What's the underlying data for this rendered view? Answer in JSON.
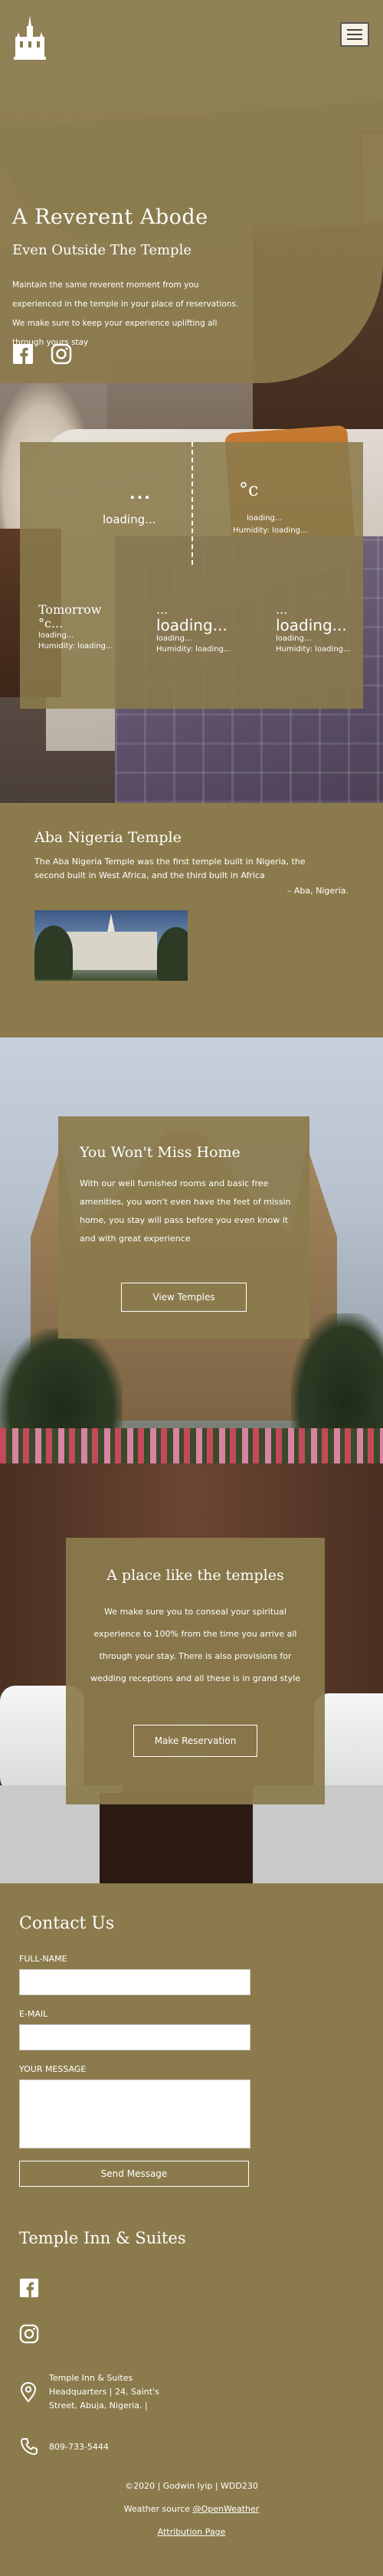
{
  "header": {
    "menu_icon": "hamburger-icon",
    "logo_icon": "temple-logo-icon"
  },
  "hero": {
    "title": "A Reverent Abode",
    "subtitle": "Even Outside The Temple",
    "description": "Maintain the same reverent moment from you experienced in the temple in your place of reservations. We make sure to keep your experience uplifting all through yours stay",
    "social": [
      "facebook-icon",
      "instagram-icon"
    ]
  },
  "weather": {
    "current_icon": "...",
    "current_status": "loading...",
    "current_temp": "°c",
    "current_line1": "loading...",
    "current_line2": "Humidity: loading...",
    "forecast": [
      {
        "day": "Tomorrow",
        "temp": "°c...",
        "line1": "loading...",
        "line2": "Humidity: loading..."
      },
      {
        "day": "...",
        "temp": "loading...",
        "line1": "loading...",
        "line2": "Humidity: loading..."
      },
      {
        "day": "...",
        "temp": "loading...",
        "line1": "loading...",
        "line2": "Humidity: loading..."
      }
    ]
  },
  "aba": {
    "title": "Aba Nigeria Temple",
    "description": "The Aba Nigeria Temple was the first temple built in Nigeria, the second built in West Africa, and the third built in Africa",
    "credit": "– Aba, Nigeria."
  },
  "home": {
    "title": "You Won't Miss Home",
    "description": "With our well furnished rooms and basic free amenities, you won't even have the feet of missin home, you stay will pass before you even know it and with great experience",
    "button": "View Temples"
  },
  "place": {
    "title": "A place like the temples",
    "description": "We make sure you to conseal your spiritual experience to 100% from the time you arrive all through your stay. There is also provisions for wedding receptions and all these is in grand style",
    "button": "Make Reservation"
  },
  "contact": {
    "title": "Contact Us",
    "full_name_label": "FULL-NAME",
    "email_label": "E-MAIL",
    "message_label": "YOUR MESSAGE",
    "full_name_value": "",
    "email_value": "",
    "message_value": "",
    "send_button": "Send Message"
  },
  "footer": {
    "title": "Temple Inn & Suites",
    "address": "Temple Inn & Suites Headquarters | 24, Saint's Street, Abuja, Nigeria. |",
    "phone": "809-733-5444",
    "copyright": "©2020 | Godwin Iyip | WDD230",
    "weather_source_prefix": "Weather source ",
    "weather_source_link": "@OpenWeather",
    "attribution": "Attribution Page"
  },
  "colors": {
    "brand_olive": "#8b7b4c",
    "text": "#ffffff"
  }
}
